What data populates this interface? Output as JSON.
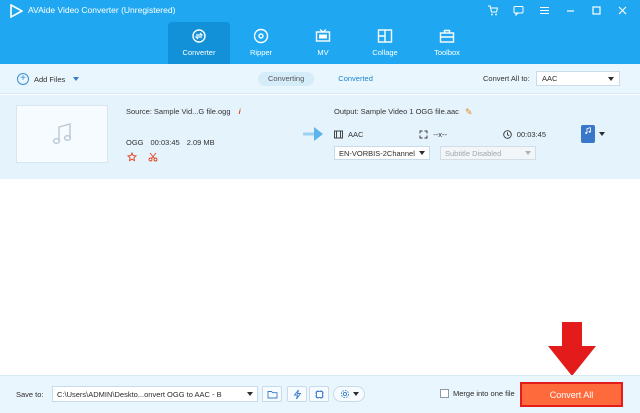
{
  "app": {
    "title": "AVAide Video Converter (Unregistered)"
  },
  "window_controls": [
    "cart-icon",
    "chat-icon",
    "menu-icon",
    "minimize-icon",
    "maximize-icon",
    "close-icon"
  ],
  "nav": [
    {
      "label": "Converter",
      "icon": "converter-icon",
      "active": true
    },
    {
      "label": "Ripper",
      "icon": "disc-icon",
      "active": false
    },
    {
      "label": "MV",
      "icon": "tv-icon",
      "active": false
    },
    {
      "label": "Collage",
      "icon": "collage-icon",
      "active": false
    },
    {
      "label": "Toolbox",
      "icon": "toolbox-icon",
      "active": false
    }
  ],
  "toolbar": {
    "add_files": "Add Files",
    "tabs": [
      {
        "label": "Converting",
        "active": true
      },
      {
        "label": "Converted",
        "active": false
      }
    ],
    "convert_all_label": "Convert All to:",
    "convert_all_value": "AAC"
  },
  "file": {
    "source": "Source: Sample Vid...G file.ogg",
    "src_format": "OGG",
    "src_duration": "00:03:45",
    "src_size": "2.09 MB",
    "output": "Output: Sample Video 1 OGG file.aac",
    "out_format": "AAC",
    "out_resolution": "--x--",
    "out_duration": "00:03:45",
    "audio_track": "EN-VORBIS-2Channel",
    "subtitle": "Subtitle Disabled"
  },
  "bottom": {
    "save_label": "Save to:",
    "save_path": "C:\\Users\\ADMIN\\Deskto...onvert OGG to AAC - B",
    "merge_label": "Merge into one file",
    "convert_all": "Convert All"
  },
  "colors": {
    "accent": "#1fa8f1",
    "convert_button": "#ff6a3d",
    "highlight": "#e31b1b"
  }
}
